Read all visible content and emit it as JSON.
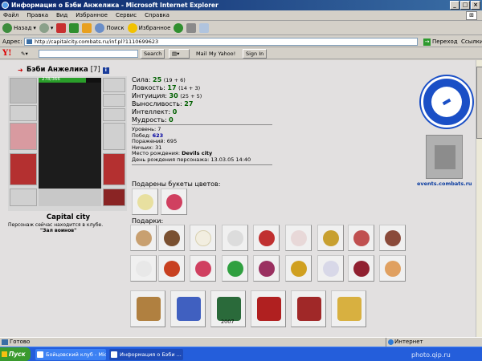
{
  "window": {
    "title": "Информация о Бэби Анжелика - Microsoft Internet Explorer"
  },
  "menu": [
    "Файл",
    "Правка",
    "Вид",
    "Избранное",
    "Сервис",
    "Справка"
  ],
  "toolbar": {
    "back": "Назад",
    "search": "Поиск",
    "favorites": "Избранное"
  },
  "address": {
    "label": "Адрес:",
    "url": "http://capitalcity.combats.ru/inf.pl?1110699623",
    "go": "Переход",
    "links": "Ссылки"
  },
  "yahoo": {
    "logo": "Y!",
    "search": "Search",
    "mail": "Mail",
    "my_yahoo": "My Yahoo!",
    "sign_in": "Sign In"
  },
  "character": {
    "name": "Бэби Анжелика",
    "level": "[7]",
    "info_badge": "i",
    "hp": "278/366",
    "hp_fraction": 0.76,
    "location": "Capital city",
    "presence_line1": "Персонаж сейчас находится в клубе.",
    "presence_line2": "\"Зал воинов\""
  },
  "stats": [
    {
      "label": "Сила:",
      "value": "25",
      "extra": "(19 + 6)"
    },
    {
      "label": "Ловкость:",
      "value": "17",
      "extra": "(14 + 3)"
    },
    {
      "label": "Интуиция:",
      "value": "30",
      "extra": "(25 + 5)"
    },
    {
      "label": "Выносливость:",
      "value": "27",
      "extra": ""
    },
    {
      "label": "Интеллект:",
      "value": "0",
      "extra": ""
    },
    {
      "label": "Мудрость:",
      "value": "0",
      "extra": ""
    }
  ],
  "details": [
    {
      "label": "Уровень:",
      "value": "7"
    },
    {
      "label": "Побед:",
      "value": "623"
    },
    {
      "label": "Поражений:",
      "value": "695"
    },
    {
      "label": "Ничьих:",
      "value": "31"
    },
    {
      "label": "Место рождения:",
      "value": "Devils city"
    },
    {
      "label": "День рождения персонажа:",
      "value": "13.03.05 14:40"
    }
  ],
  "bouquets_title": "Подарены букеты цветов:",
  "gifts_title": "Подарки:",
  "big_gift_year": "2007",
  "emblem_link": "events.combats.ru",
  "status": {
    "ready": "Готово",
    "zone": "Интернет"
  },
  "taskbar": {
    "start": "Пуск",
    "task1": "Бойцовский клуб - Micr...",
    "task2": "Информация о Бэби ..."
  },
  "watermark": "photo.qip.ru",
  "colors": {
    "title_bar": "#0a246a",
    "stat_value": "#006000",
    "emblem": "#1a4fc6",
    "taskbar": "#245edb"
  }
}
